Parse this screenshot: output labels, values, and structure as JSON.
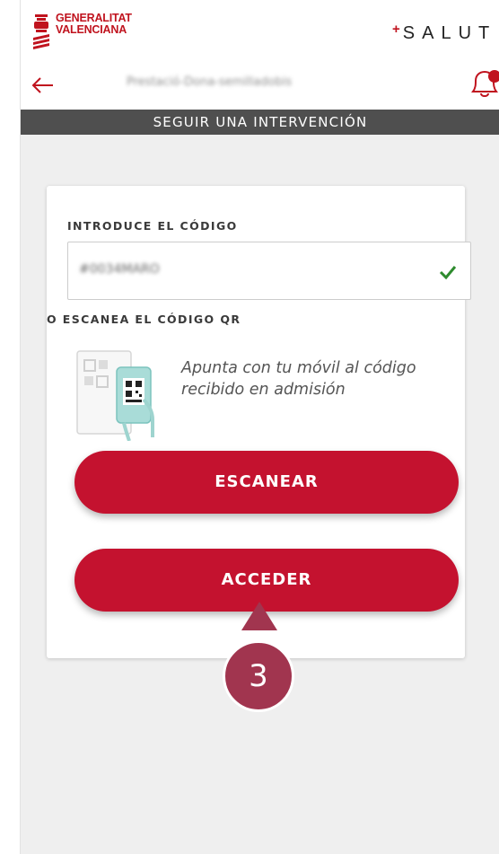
{
  "header": {
    "logo_line1": "GENERALITAT",
    "logo_line2": "VALENCIANA",
    "brand_plus": "+",
    "brand": "SALUT"
  },
  "nav": {
    "title": "Prestació-Dona-semilladobis",
    "back_icon": "arrow-left-icon",
    "bell_icon": "bell-icon"
  },
  "page": {
    "heading": "SEGUIR UNA INTERVENCIÓN"
  },
  "form": {
    "code_label": "INTRODUCE EL CÓDIGO",
    "code_value": "#0034MARO",
    "qr_label": "O ESCANEA EL CÓDIGO QR",
    "qr_hint": "Apunta con tu móvil al código recibido en admisión",
    "scan_button": "ESCANEAR",
    "access_button": "ACCEDER"
  },
  "annotation": {
    "step_number": "3"
  },
  "colors": {
    "brand_red": "#c0131e",
    "button_red": "#c4122f",
    "subheader_gray": "#4f4f4f",
    "check_green": "#2e8b2e",
    "step_badge": "#a1354f"
  }
}
